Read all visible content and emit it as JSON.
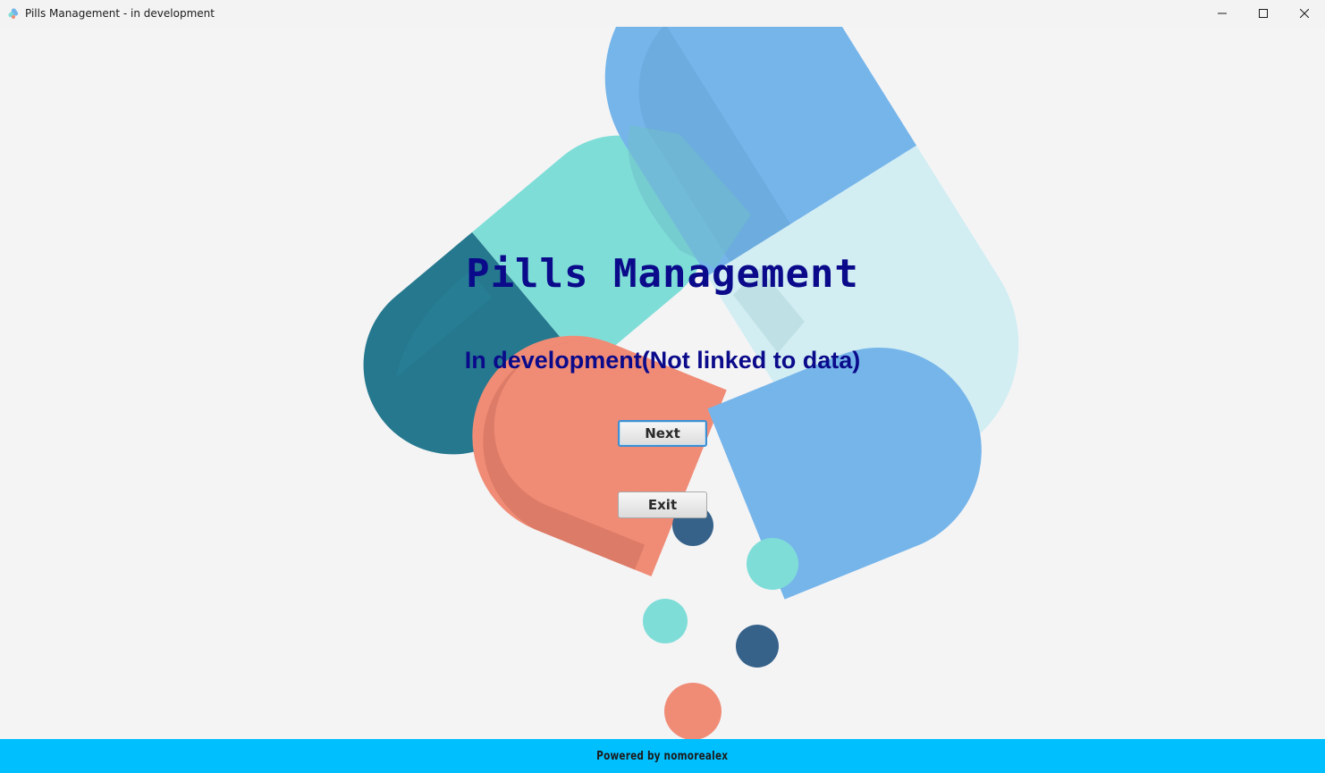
{
  "window": {
    "title": "Pills Management - in development",
    "app_icon": "pills-app-icon",
    "controls": {
      "minimize_icon": "minimize-icon",
      "maximize_icon": "maximize-icon",
      "close_icon": "close-icon"
    }
  },
  "main": {
    "heading": "Pills Management",
    "subheading": "In development(Not linked to data)",
    "next_label": "Next",
    "exit_label": "Exit",
    "illustration": "pills-capsules-illustration"
  },
  "footer": {
    "text": "Powered by nomorealex"
  },
  "colors": {
    "heading": "#0a0a8a",
    "footer_bg": "#00bfff",
    "pill_teal_dark": "#25788e",
    "pill_teal_light": "#7fddd8",
    "pill_blue": "#76b5ea",
    "pill_blue_pale": "#d2eef3",
    "pill_salmon": "#f08c76",
    "dot_navy": "#36628a"
  }
}
